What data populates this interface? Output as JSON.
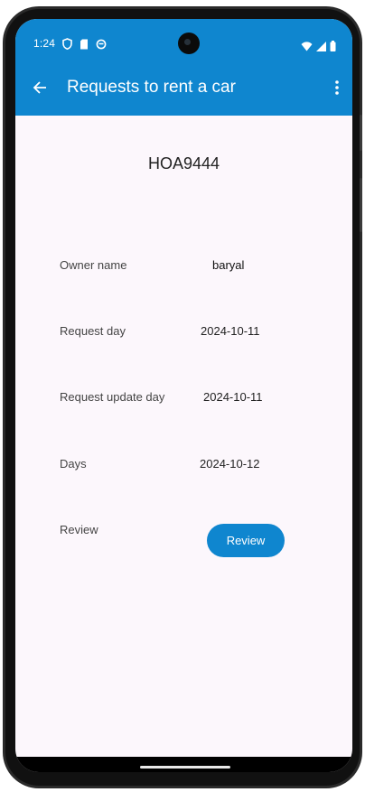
{
  "status_bar": {
    "time": "1:24",
    "left_icons": [
      "vpn-shield-icon",
      "sim-card-icon",
      "sync-icon"
    ],
    "right_icons": [
      "wifi-icon",
      "cellular-signal-icon",
      "battery-icon"
    ]
  },
  "app_bar": {
    "title": "Requests to rent a car",
    "back_icon": "arrow-back-icon",
    "menu_icon": "more-vert-icon"
  },
  "request": {
    "plate": "HOA9444",
    "rows": [
      {
        "label": "Owner name",
        "value": "baryal"
      },
      {
        "label": "Request day",
        "value": "2024-10-11"
      },
      {
        "label": "Request update day",
        "value": "2024-10-11"
      },
      {
        "label": "Days",
        "value": "2024-10-12"
      }
    ],
    "review_label": "Review",
    "review_button": "Review"
  },
  "colors": {
    "primary": "#0f86cf",
    "background": "#fcf7fc"
  }
}
